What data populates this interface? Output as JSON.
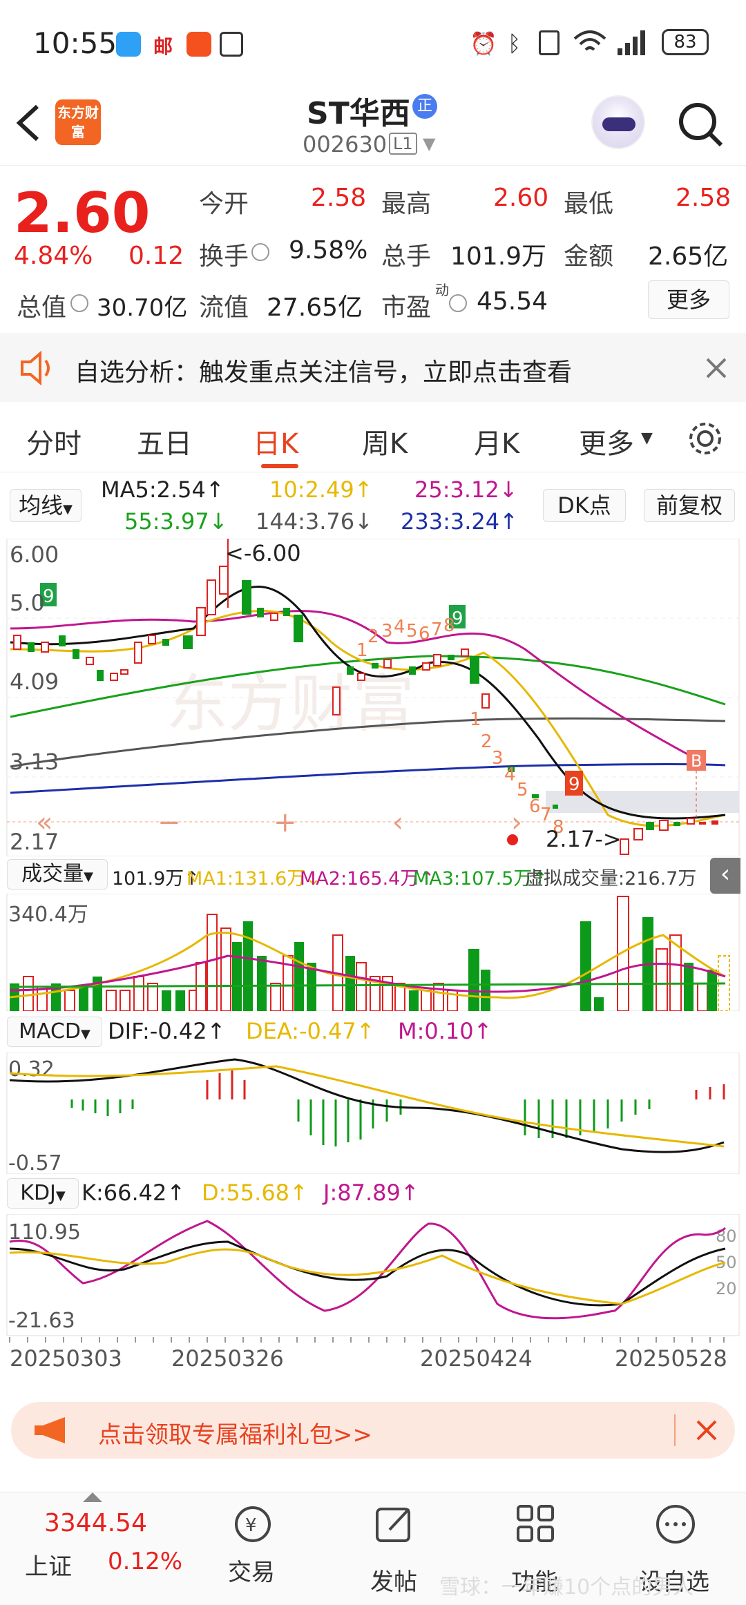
{
  "status": {
    "time": "10:55",
    "battery": "83"
  },
  "header": {
    "title": "ST华西",
    "code": "002630",
    "market": "L1",
    "logo_text": "东方财富"
  },
  "quote": {
    "price": "2.60",
    "pct": "4.84%",
    "change": "0.12",
    "open_label": "今开",
    "open": "2.58",
    "high_label": "最高",
    "high": "2.60",
    "low_label": "最低",
    "low": "2.58",
    "turnover_label": "换手",
    "turnover": "9.58%",
    "vol_label": "总手",
    "vol": "101.9万",
    "amount_label": "金额",
    "amount": "2.65亿",
    "mcap_label": "总值",
    "mcap": "30.70亿",
    "float_label": "流值",
    "float": "27.65亿",
    "pe_label": "市盈",
    "pe_sup": "动",
    "pe": "45.54",
    "more_label": "更多"
  },
  "notice": {
    "text": "自选分析：触发重点关注信号，立即点击查看"
  },
  "tabs": [
    "分时",
    "五日",
    "日K",
    "周K",
    "月K",
    "更多"
  ],
  "ma": {
    "selector": "均线",
    "ma5": "MA5:2.54↑",
    "ma10": "10:2.49↑",
    "ma25": "25:3.12↓",
    "ma55": "55:3.97↓",
    "ma144": "144:3.76↓",
    "ma233": "233:3.24↑",
    "dk": "DK点",
    "adjust": "前复权"
  },
  "chart_data": {
    "type": "candlestick",
    "y_labels": [
      "6.00",
      "5.0",
      "4.09",
      "3.13",
      "2.17"
    ],
    "annotations": [
      "<-6.00",
      "2.17->"
    ],
    "buy_signal": "B",
    "td_counts": [
      "9",
      "1",
      "2",
      "3",
      "4",
      "5",
      "6",
      "7",
      "8",
      "9",
      "1",
      "2",
      "3",
      "4",
      "5",
      "6",
      "7",
      "8",
      "9"
    ],
    "x_labels": [
      "20250303",
      "20250326",
      "20250424",
      "20250528"
    ]
  },
  "volume": {
    "selector": "成交量",
    "value": "101.9万↑",
    "ma1": "MA1:131.6万↓",
    "ma2": "MA2:165.4万↑",
    "ma3": "MA3:107.5万↑",
    "virtual": "虚拟成交量:216.7万",
    "max_label": "340.4万"
  },
  "macd": {
    "selector": "MACD",
    "dif": "DIF:-0.42↑",
    "dea": "DEA:-0.47↑",
    "m": "M:0.10↑",
    "top": "0.32",
    "bottom": "-0.57"
  },
  "kdj": {
    "selector": "KDJ",
    "k": "K:66.42↑",
    "d": "D:55.68↑",
    "j": "J:87.89↑",
    "top": "110.95",
    "bottom": "-21.63",
    "r80": "80",
    "r50": "50",
    "r20": "20"
  },
  "promo": {
    "text": "点击领取专属福利礼包>>"
  },
  "bottom_nav": {
    "index_value": "3344.54",
    "index_name": "上证",
    "index_pct": "0.12%",
    "trade": "交易",
    "post": "发帖",
    "func": "功能",
    "watch": "设自选"
  },
  "watermark": "雪球：一年赚10个点的男人"
}
